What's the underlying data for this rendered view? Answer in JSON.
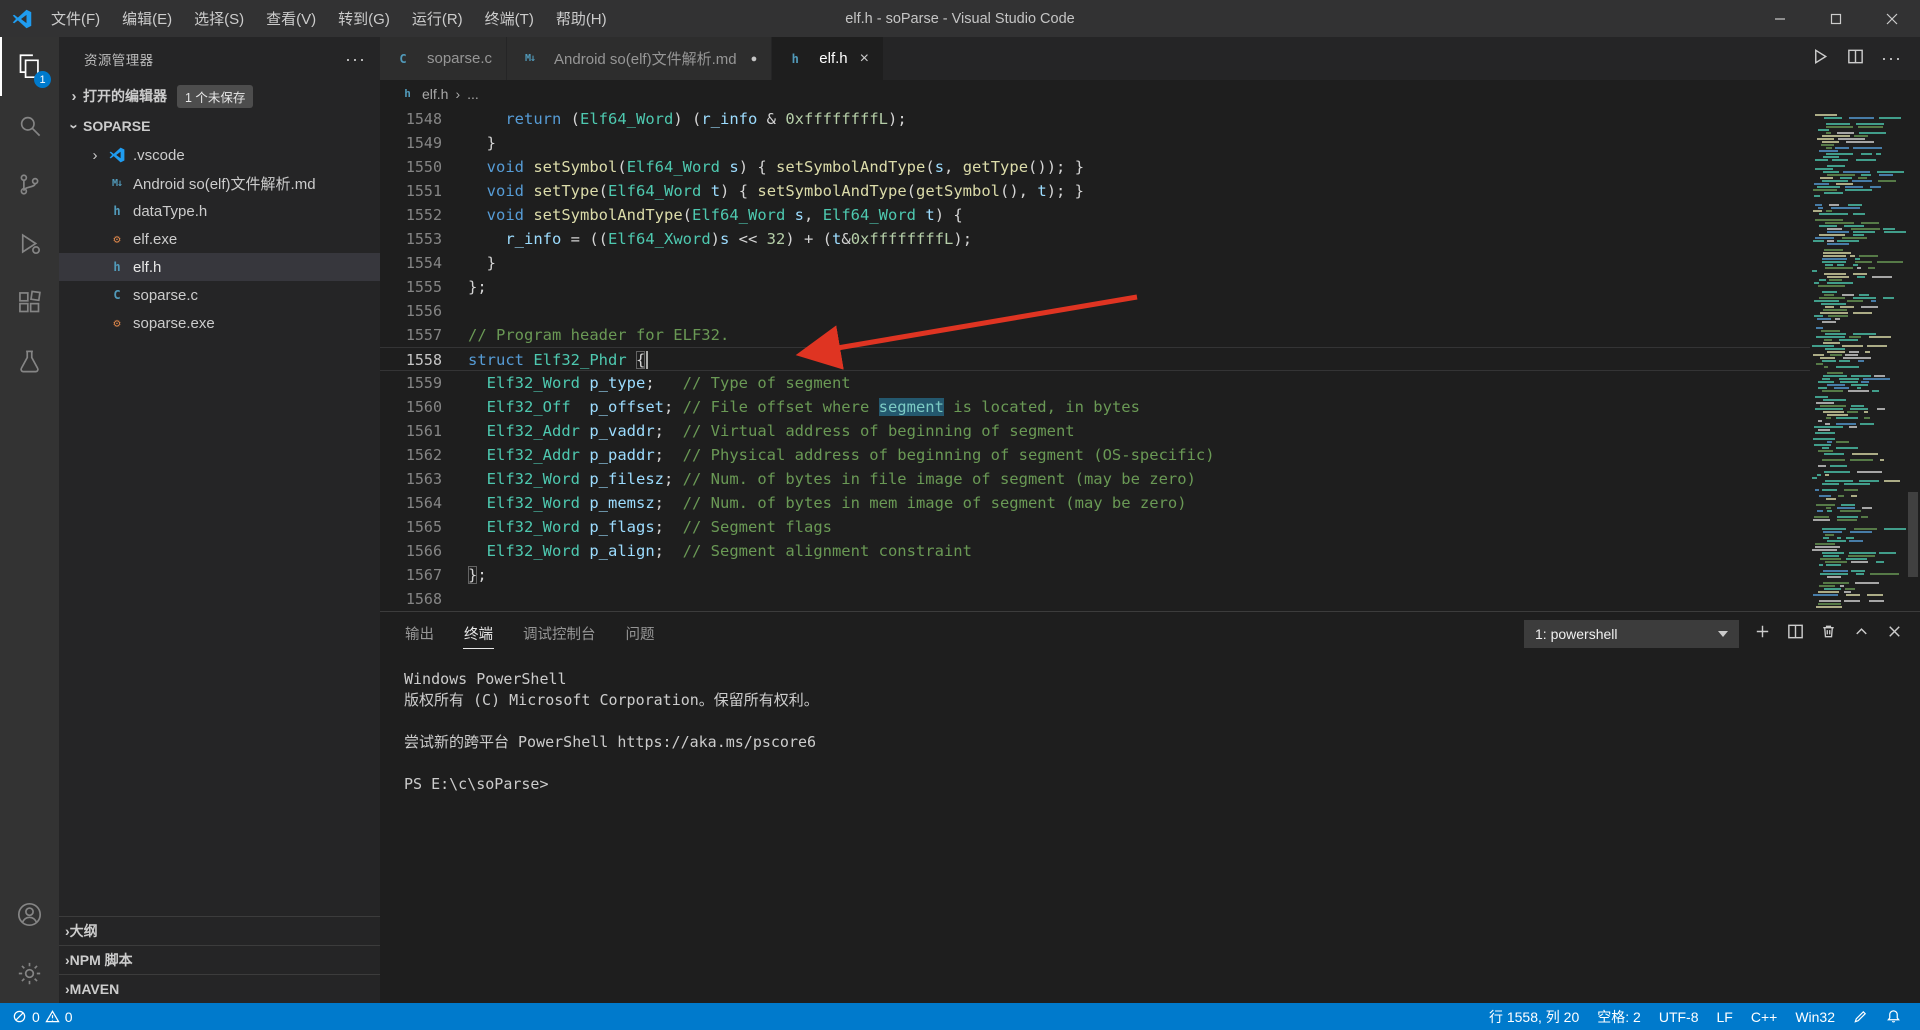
{
  "titlebar": {
    "title": "elf.h - soParse - Visual Studio Code",
    "menus": [
      "文件(F)",
      "编辑(E)",
      "选择(S)",
      "查看(V)",
      "转到(G)",
      "运行(R)",
      "终端(T)",
      "帮助(H)"
    ]
  },
  "activity_bar": {
    "explorer_badge": "1",
    "items": [
      "explorer",
      "search",
      "source-control",
      "run-debug",
      "extensions",
      "testing"
    ],
    "bottom_items": [
      "account",
      "settings"
    ]
  },
  "sidebar": {
    "header": "资源管理器",
    "more": "···",
    "open_editors": {
      "label": "打开的编辑器",
      "badge": "1 个未保存"
    },
    "project": "SOPARSE",
    "files": [
      {
        "name": ".vscode",
        "icon": "vscode",
        "folder": true
      },
      {
        "name": "Android so(elf)文件解析.md",
        "icon": "md"
      },
      {
        "name": "dataType.h",
        "icon": "h"
      },
      {
        "name": "elf.exe",
        "icon": "exe"
      },
      {
        "name": "elf.h",
        "icon": "h",
        "selected": true
      },
      {
        "name": "soparse.c",
        "icon": "c"
      },
      {
        "name": "soparse.exe",
        "icon": "exe"
      }
    ],
    "bottom_sections": [
      "大纲",
      "NPM 脚本",
      "MAVEN"
    ]
  },
  "tabs": [
    {
      "label": "soparse.c",
      "icon": "c"
    },
    {
      "label": "Android so(elf)文件解析.md",
      "icon": "md",
      "modified": true
    },
    {
      "label": "elf.h",
      "icon": "h",
      "active": true
    }
  ],
  "breadcrumb": {
    "file": "elf.h",
    "separator": "›",
    "more": "..."
  },
  "editor": {
    "lines": [
      {
        "num": 1548,
        "tokens": [
          [
            "pln",
            "    "
          ],
          [
            "kw",
            "return"
          ],
          [
            "pln",
            " ("
          ],
          [
            "typ",
            "Elf64_Word"
          ],
          [
            "pln",
            ") ("
          ],
          [
            "var",
            "r_info"
          ],
          [
            "pln",
            " & "
          ],
          [
            "num",
            "0xffffffffL"
          ],
          [
            "pln",
            ");"
          ]
        ]
      },
      {
        "num": 1549,
        "tokens": [
          [
            "pln",
            "  }"
          ]
        ]
      },
      {
        "num": 1550,
        "tokens": [
          [
            "pln",
            "  "
          ],
          [
            "kw",
            "void"
          ],
          [
            "pln",
            " "
          ],
          [
            "fn",
            "setSymbol"
          ],
          [
            "pln",
            "("
          ],
          [
            "typ",
            "Elf64_Word"
          ],
          [
            "pln",
            " "
          ],
          [
            "var",
            "s"
          ],
          [
            "pln",
            ") { "
          ],
          [
            "fn",
            "setSymbolAndType"
          ],
          [
            "pln",
            "("
          ],
          [
            "var",
            "s"
          ],
          [
            "pln",
            ", "
          ],
          [
            "fn",
            "getType"
          ],
          [
            "pln",
            "()); }"
          ]
        ]
      },
      {
        "num": 1551,
        "tokens": [
          [
            "pln",
            "  "
          ],
          [
            "kw",
            "void"
          ],
          [
            "pln",
            " "
          ],
          [
            "fn",
            "setType"
          ],
          [
            "pln",
            "("
          ],
          [
            "typ",
            "Elf64_Word"
          ],
          [
            "pln",
            " "
          ],
          [
            "var",
            "t"
          ],
          [
            "pln",
            ") { "
          ],
          [
            "fn",
            "setSymbolAndType"
          ],
          [
            "pln",
            "("
          ],
          [
            "fn",
            "getSymbol"
          ],
          [
            "pln",
            "(), "
          ],
          [
            "var",
            "t"
          ],
          [
            "pln",
            "); }"
          ]
        ]
      },
      {
        "num": 1552,
        "tokens": [
          [
            "pln",
            "  "
          ],
          [
            "kw",
            "void"
          ],
          [
            "pln",
            " "
          ],
          [
            "fn",
            "setSymbolAndType"
          ],
          [
            "pln",
            "("
          ],
          [
            "typ",
            "Elf64_Word"
          ],
          [
            "pln",
            " "
          ],
          [
            "var",
            "s"
          ],
          [
            "pln",
            ", "
          ],
          [
            "typ",
            "Elf64_Word"
          ],
          [
            "pln",
            " "
          ],
          [
            "var",
            "t"
          ],
          [
            "pln",
            ") {"
          ]
        ]
      },
      {
        "num": 1553,
        "tokens": [
          [
            "pln",
            "    "
          ],
          [
            "var",
            "r_info"
          ],
          [
            "pln",
            " = (("
          ],
          [
            "typ",
            "Elf64_Xword"
          ],
          [
            "pln",
            ")"
          ],
          [
            "var",
            "s"
          ],
          [
            "pln",
            " << "
          ],
          [
            "num",
            "32"
          ],
          [
            "pln",
            ") + ("
          ],
          [
            "var",
            "t"
          ],
          [
            "pln",
            "&"
          ],
          [
            "num",
            "0xffffffffL"
          ],
          [
            "pln",
            ");"
          ]
        ]
      },
      {
        "num": 1554,
        "tokens": [
          [
            "pln",
            "  }"
          ]
        ]
      },
      {
        "num": 1555,
        "tokens": [
          [
            "pln",
            "};"
          ]
        ]
      },
      {
        "num": 1556,
        "tokens": []
      },
      {
        "num": 1557,
        "tokens": [
          [
            "cmt",
            "// Program header for ELF32."
          ]
        ]
      },
      {
        "num": 1558,
        "current": true,
        "tokens": [
          [
            "kw",
            "struct"
          ],
          [
            "pln",
            " "
          ],
          [
            "typ",
            "Elf32_Phdr"
          ],
          [
            "pln",
            " "
          ],
          [
            "bm",
            "{"
          ],
          [
            "cur",
            ""
          ]
        ]
      },
      {
        "num": 1559,
        "tokens": [
          [
            "pln",
            "  "
          ],
          [
            "typ",
            "Elf32_Word"
          ],
          [
            "pln",
            " "
          ],
          [
            "var",
            "p_type"
          ],
          [
            "pln",
            ";   "
          ],
          [
            "cmt",
            "// Type of segment"
          ]
        ]
      },
      {
        "num": 1560,
        "tokens": [
          [
            "pln",
            "  "
          ],
          [
            "typ",
            "Elf32_Off"
          ],
          [
            "pln",
            "  "
          ],
          [
            "var",
            "p_offset"
          ],
          [
            "pln",
            "; "
          ],
          [
            "cmt",
            "// File offset where "
          ],
          [
            "cmthl",
            "segment"
          ],
          [
            "cmt",
            " is located, in bytes"
          ]
        ]
      },
      {
        "num": 1561,
        "tokens": [
          [
            "pln",
            "  "
          ],
          [
            "typ",
            "Elf32_Addr"
          ],
          [
            "pln",
            " "
          ],
          [
            "var",
            "p_vaddr"
          ],
          [
            "pln",
            ";  "
          ],
          [
            "cmt",
            "// Virtual address of beginning of segment"
          ]
        ]
      },
      {
        "num": 1562,
        "tokens": [
          [
            "pln",
            "  "
          ],
          [
            "typ",
            "Elf32_Addr"
          ],
          [
            "pln",
            " "
          ],
          [
            "var",
            "p_paddr"
          ],
          [
            "pln",
            ";  "
          ],
          [
            "cmt",
            "// Physical address of beginning of segment (OS-specific)"
          ]
        ]
      },
      {
        "num": 1563,
        "tokens": [
          [
            "pln",
            "  "
          ],
          [
            "typ",
            "Elf32_Word"
          ],
          [
            "pln",
            " "
          ],
          [
            "var",
            "p_filesz"
          ],
          [
            "pln",
            "; "
          ],
          [
            "cmt",
            "// Num. of bytes in file image of segment (may be zero)"
          ]
        ]
      },
      {
        "num": 1564,
        "tokens": [
          [
            "pln",
            "  "
          ],
          [
            "typ",
            "Elf32_Word"
          ],
          [
            "pln",
            " "
          ],
          [
            "var",
            "p_memsz"
          ],
          [
            "pln",
            ";  "
          ],
          [
            "cmt",
            "// Num. of bytes in mem image of segment (may be zero)"
          ]
        ]
      },
      {
        "num": 1565,
        "tokens": [
          [
            "pln",
            "  "
          ],
          [
            "typ",
            "Elf32_Word"
          ],
          [
            "pln",
            " "
          ],
          [
            "var",
            "p_flags"
          ],
          [
            "pln",
            ";  "
          ],
          [
            "cmt",
            "// Segment flags"
          ]
        ]
      },
      {
        "num": 1566,
        "tokens": [
          [
            "pln",
            "  "
          ],
          [
            "typ",
            "Elf32_Word"
          ],
          [
            "pln",
            " "
          ],
          [
            "var",
            "p_align"
          ],
          [
            "pln",
            ";  "
          ],
          [
            "cmt",
            "// Segment alignment constraint"
          ]
        ]
      },
      {
        "num": 1567,
        "tokens": [
          [
            "bm",
            "}"
          ],
          [
            "pln",
            ";"
          ]
        ]
      },
      {
        "num": 1568,
        "tokens": []
      }
    ]
  },
  "annotation": {
    "description": "red arrow pointing at struct Elf32_Phdr",
    "color": "#df3422"
  },
  "panel": {
    "tabs": [
      "输出",
      "终端",
      "调试控制台",
      "问题"
    ],
    "active_tab": "终端",
    "shell_select": "1: powershell",
    "terminal_lines": [
      "Windows PowerShell",
      "版权所有 (C) Microsoft Corporation。保留所有权利。",
      "",
      "尝试新的跨平台 PowerShell https://aka.ms/pscore6",
      "",
      "PS E:\\c\\soParse>"
    ]
  },
  "statusbar": {
    "errors": "0",
    "warnings": "0",
    "cursor_position": "行 1558, 列 20",
    "indent": "空格: 2",
    "encoding": "UTF-8",
    "eol": "LF",
    "language": "C++",
    "platform": "Win32"
  }
}
